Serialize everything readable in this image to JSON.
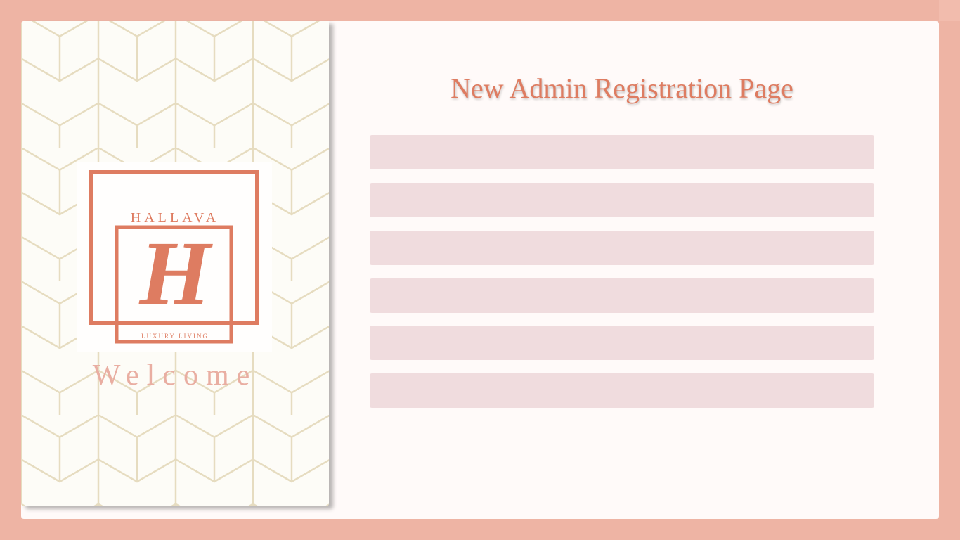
{
  "page": {
    "title": "New Admin Registration Page"
  },
  "brand": {
    "name": "HALLAVA",
    "monogram": "H",
    "tagline": "LUXURY LIVING",
    "welcome": "Welcome",
    "accent_color": "#de7c61"
  },
  "form": {
    "fields": [
      {
        "value": "",
        "placeholder": ""
      },
      {
        "value": "",
        "placeholder": ""
      },
      {
        "value": "",
        "placeholder": ""
      },
      {
        "value": "",
        "placeholder": ""
      },
      {
        "value": "",
        "placeholder": ""
      },
      {
        "value": "",
        "placeholder": ""
      }
    ]
  }
}
